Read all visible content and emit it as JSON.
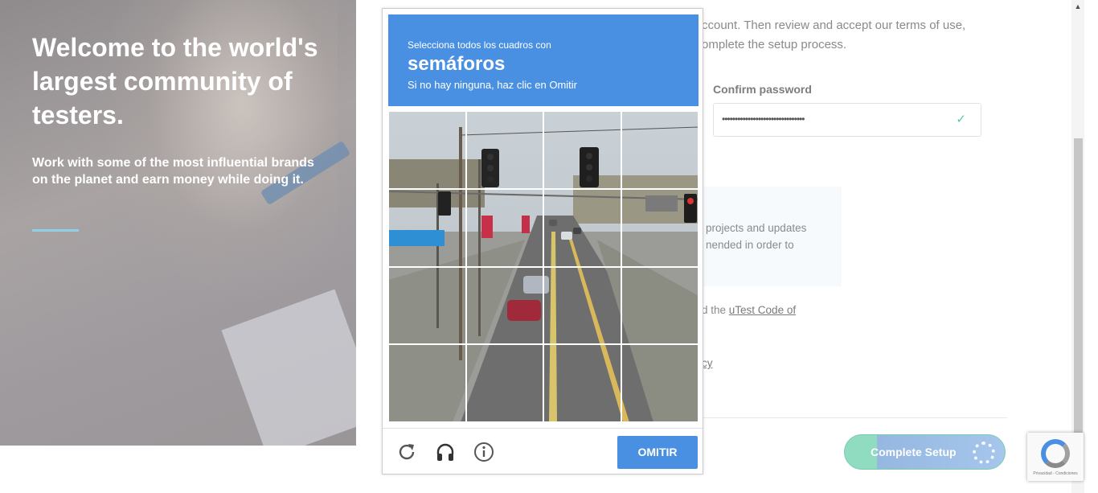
{
  "hero": {
    "title": "Welcome to the world's largest community of testers.",
    "subtitle": "Work with some of the most influential brands on the planet and earn money while doing it."
  },
  "form": {
    "intro_line1": "ccount. Then review and accept our terms of use,",
    "intro_line2": "omplete the setup process.",
    "confirm_password_label": "Confirm password",
    "confirm_password_value": "••••••••••••••••••••••••••••••••",
    "notice_text": "projects and updates nended in order to",
    "code_prefix": "d the ",
    "code_link": "uTest Code of",
    "cy_text": "cy",
    "complete_setup_label": "Complete Setup"
  },
  "captcha": {
    "instruction": "Selecciona todos los cuadros con",
    "keyword": "semáforos",
    "hint": "Si no hay ninguna, haz clic en Omitir",
    "skip_label": "OMITIR",
    "icons": {
      "reload": "reload-icon",
      "audio": "headphones-icon",
      "info": "info-icon"
    }
  },
  "badge": {
    "text": "Privacidad - Condiciones"
  },
  "colors": {
    "captcha_blue": "#4a90e2",
    "success_green": "#5ac6a0",
    "accent_line": "#8fd0e6"
  }
}
